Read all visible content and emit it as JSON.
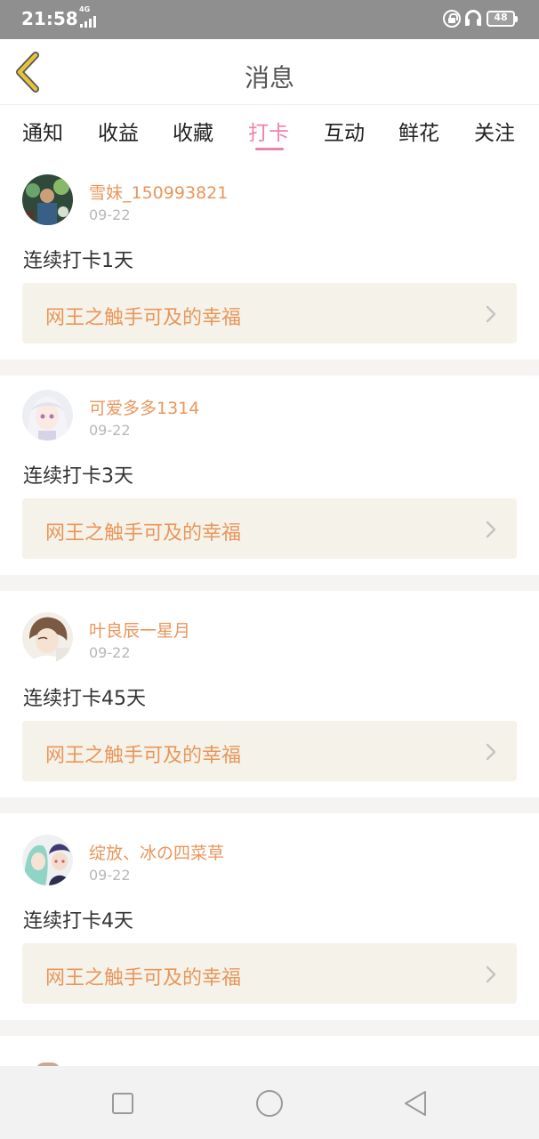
{
  "status_bar": {
    "time": "21:58",
    "network_label": "4G",
    "battery": "48"
  },
  "header": {
    "title": "消息",
    "back_icon": "chevron-left-icon"
  },
  "tabs": [
    {
      "label": "通知",
      "active": false
    },
    {
      "label": "收益",
      "active": false
    },
    {
      "label": "收藏",
      "active": false
    },
    {
      "label": "打卡",
      "active": true
    },
    {
      "label": "互动",
      "active": false
    },
    {
      "label": "鲜花",
      "active": false
    },
    {
      "label": "关注",
      "active": false
    }
  ],
  "feed": [
    {
      "username": "雪妹_150993821",
      "date": "09-22",
      "text": "连续打卡1天",
      "book_title": "网王之触手可及的幸福"
    },
    {
      "username": "可爱多多1314",
      "date": "09-22",
      "text": "连续打卡3天",
      "book_title": "网王之触手可及的幸福"
    },
    {
      "username": "叶良辰一星月",
      "date": "09-22",
      "text": "连续打卡45天",
      "book_title": "网王之触手可及的幸福"
    },
    {
      "username": "绽放、冰の四菜草",
      "date": "09-22",
      "text": "连续打卡4天",
      "book_title": "网王之触手可及的幸福"
    }
  ],
  "colors": {
    "accent_pink": "#ee82ac",
    "username_orange": "#e9965c",
    "book_bg": "#f5f3e9",
    "back_icon_yellow": "#e8c33a",
    "status_bar": "#8f8f8f"
  },
  "nav": {
    "icons": [
      "square-icon",
      "circle-icon",
      "triangle-back-icon"
    ]
  }
}
